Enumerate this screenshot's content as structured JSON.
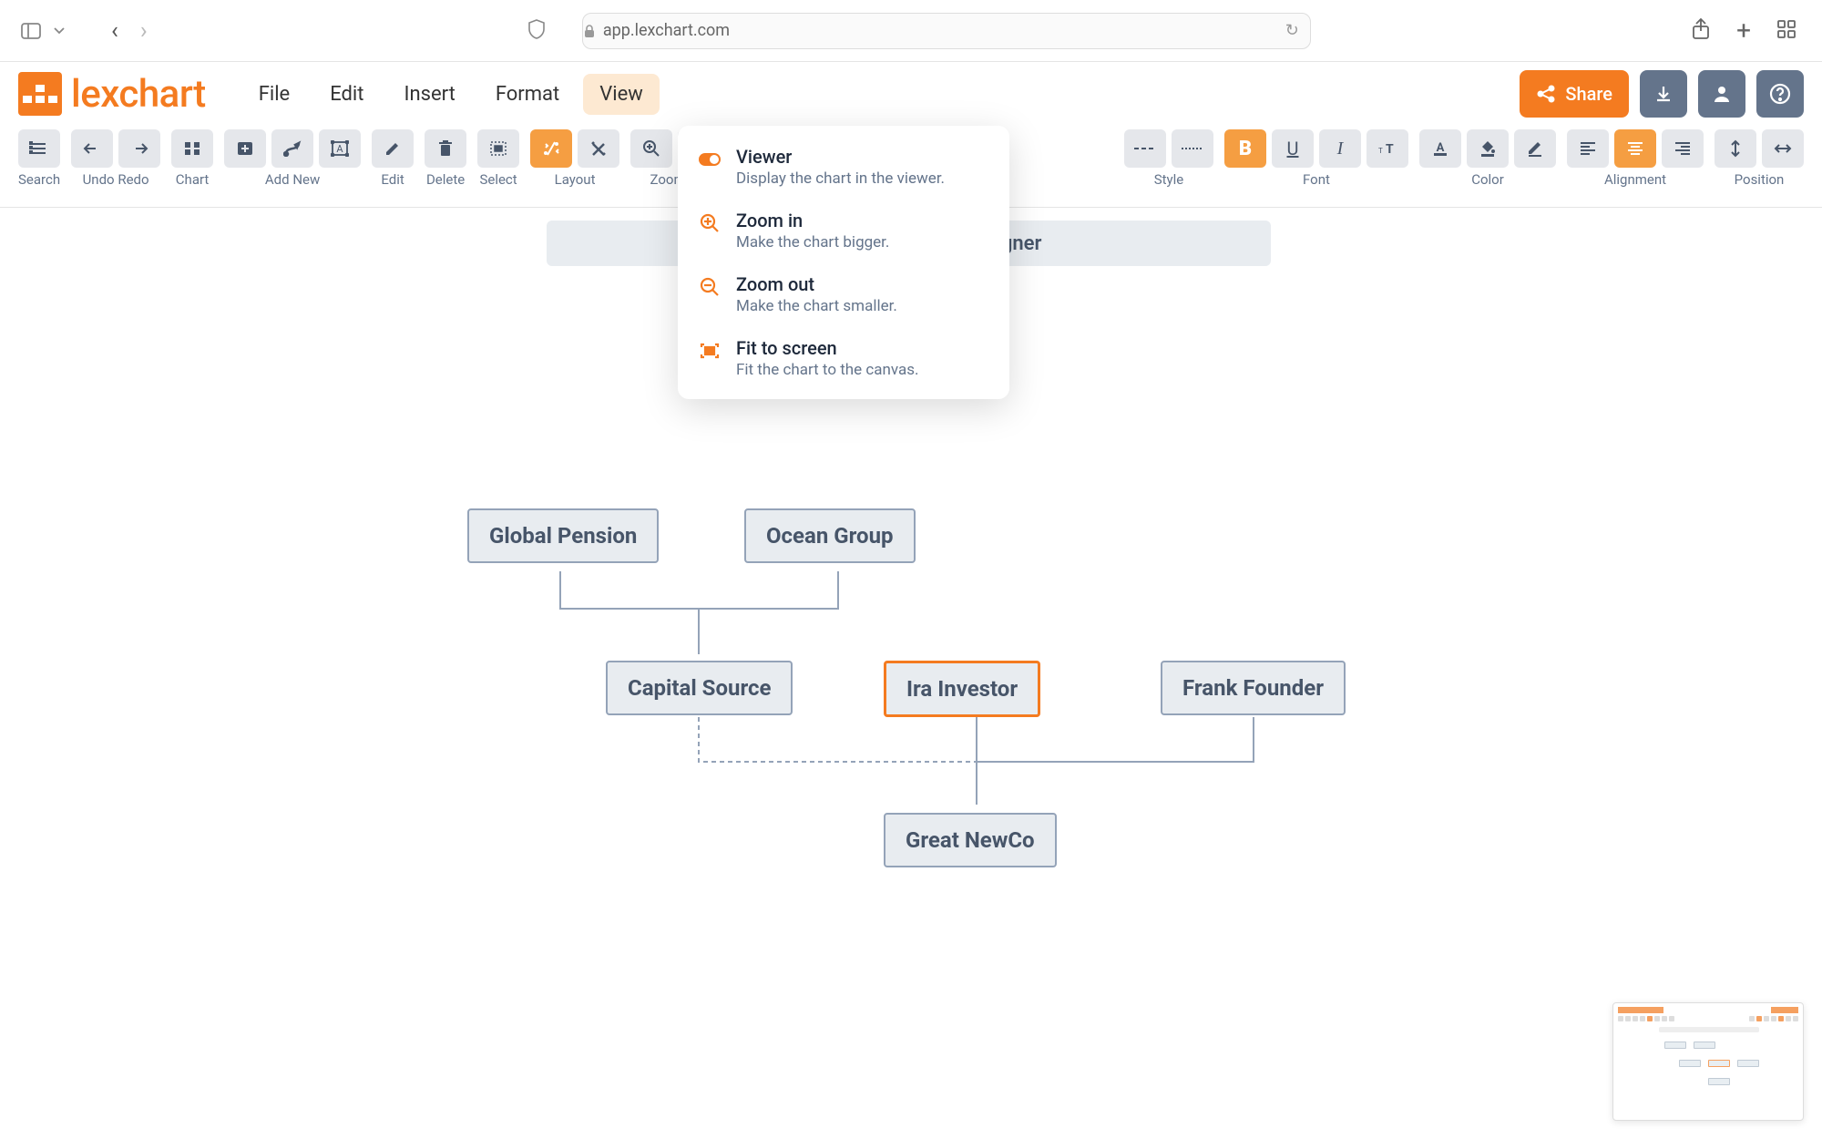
{
  "browser": {
    "url": "app.lexchart.com"
  },
  "app": {
    "logo_text": "lexchart"
  },
  "menu": {
    "file": "File",
    "edit": "Edit",
    "insert": "Insert",
    "format": "Format",
    "view": "View"
  },
  "header_buttons": {
    "share": "Share"
  },
  "toolbar_groups": {
    "search": "Search",
    "undo": "Undo",
    "redo": "Redo",
    "chart": "Chart",
    "add_new": "Add New",
    "edit": "Edit",
    "delete": "Delete",
    "select": "Select",
    "layout": "Layout",
    "zoom": "Zoom",
    "style": "Style",
    "font": "Font",
    "color": "Color",
    "alignment": "Alignment",
    "position": "Position"
  },
  "dropdown": {
    "items": [
      {
        "title": "Viewer",
        "desc": "Display the chart in the viewer."
      },
      {
        "title": "Zoom in",
        "desc": "Make the chart bigger."
      },
      {
        "title": "Zoom out",
        "desc": "Make the chart smaller."
      },
      {
        "title": "Fit to screen",
        "desc": "Fit the chart to the canvas."
      }
    ]
  },
  "title_node": "esigner",
  "chart_data": {
    "type": "diagram",
    "nodes": [
      {
        "id": "global-pension",
        "label": "Global Pension"
      },
      {
        "id": "ocean-group",
        "label": "Ocean Group"
      },
      {
        "id": "capital-source",
        "label": "Capital Source"
      },
      {
        "id": "ira-investor",
        "label": "Ira Investor",
        "selected": true
      },
      {
        "id": "frank-founder",
        "label": "Frank Founder"
      },
      {
        "id": "great-newco",
        "label": "Great NewCo"
      }
    ],
    "edges": [
      {
        "from": "global-pension",
        "to": "capital-source"
      },
      {
        "from": "ocean-group",
        "to": "capital-source"
      },
      {
        "from": "capital-source",
        "to": "great-newco",
        "dashed": true
      },
      {
        "from": "ira-investor",
        "to": "great-newco"
      },
      {
        "from": "frank-founder",
        "to": "great-newco"
      }
    ]
  }
}
